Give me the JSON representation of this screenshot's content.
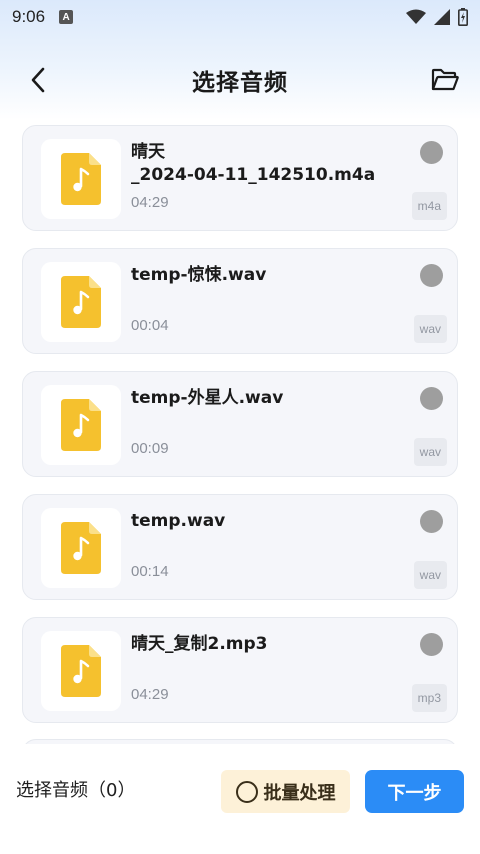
{
  "status_bar": {
    "time": "9:06",
    "notification_icon": "A"
  },
  "header": {
    "title": "选择音频",
    "back_icon": "chevron-left-icon",
    "folder_icon": "folder-open-icon"
  },
  "files": [
    {
      "name": "晴天_2024-04-11_142510.m4a",
      "name_line1": "晴天",
      "name_line2": "_2024-04-11_142510.m4a",
      "duration": "04:29",
      "ext": "m4a"
    },
    {
      "name": "temp-惊悚.wav",
      "duration": "00:04",
      "ext": "wav"
    },
    {
      "name": "temp-外星人.wav",
      "duration": "00:09",
      "ext": "wav"
    },
    {
      "name": "temp.wav",
      "duration": "00:14",
      "ext": "wav"
    },
    {
      "name": "晴天_复制2.mp3",
      "duration": "04:29",
      "ext": "mp3"
    }
  ],
  "bottom": {
    "selected_label": "选择音频（0）",
    "batch_label": "批量处理",
    "next_label": "下一步"
  },
  "colors": {
    "accent": "#2b8cf6",
    "file_icon": "#f5c12e",
    "batch_bg": "#fdf1d8"
  }
}
